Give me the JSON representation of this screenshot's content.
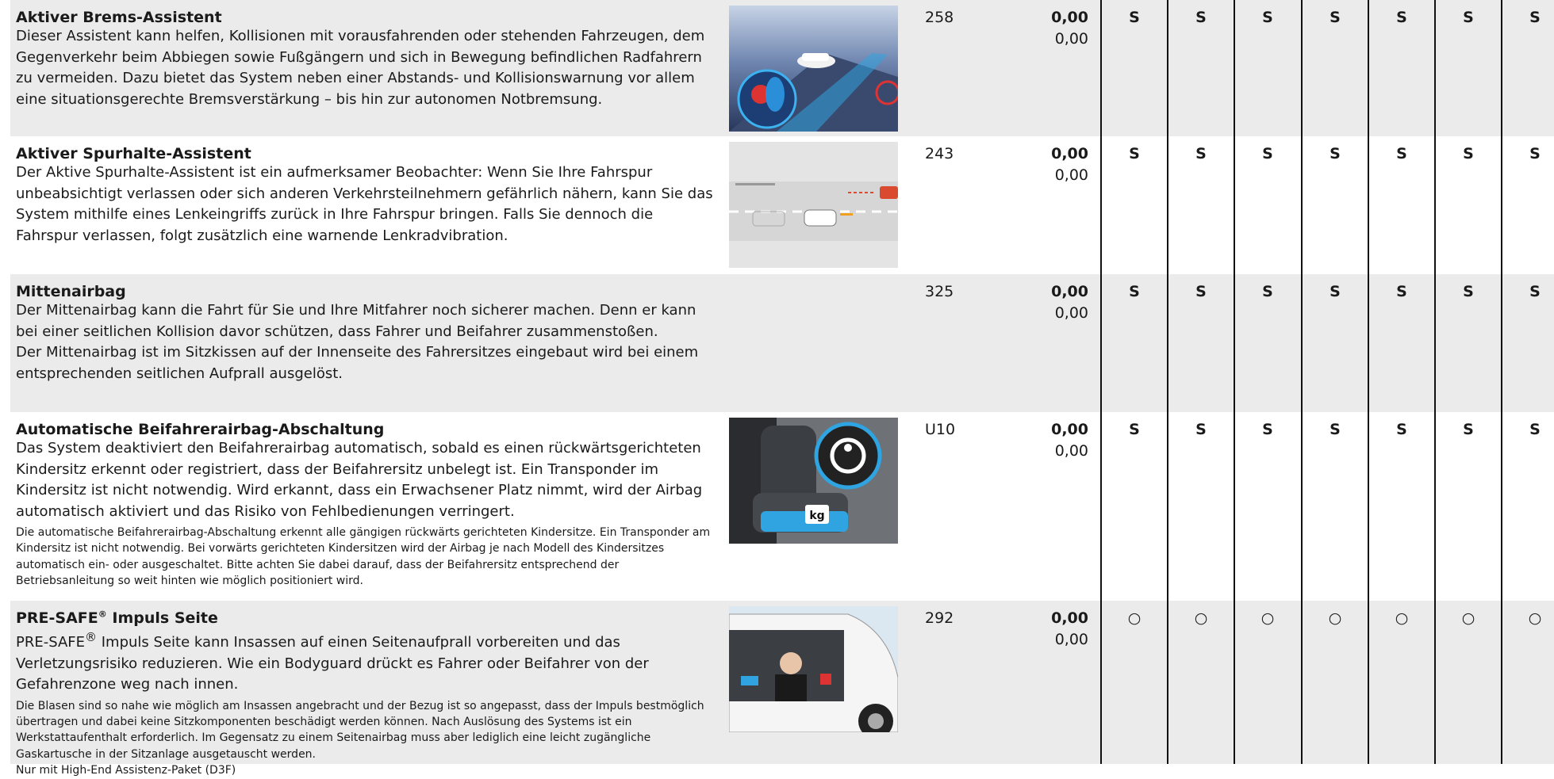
{
  "column_marks_count": 7,
  "rows": [
    {
      "title": "Aktiver Brems-Assistent",
      "body": "Dieser Assistent kann helfen, Kollisionen mit vorausfahrenden oder stehenden Fahrzeugen, dem Gegenverkehr beim Abbiegen sowie Fußgängern und sich in Bewegung befindlichen Radfahrern zu vermeiden. Dazu bietet das System neben einer Abstands- und Kollisionswarnung vor allem eine situationsgerechte Bremsverstärkung – bis hin zur autonomen Notbremsung.",
      "code": "258",
      "price_bold": "0,00",
      "price_regular": "0,00",
      "marks": [
        "S",
        "S",
        "S",
        "S",
        "S",
        "S",
        "S"
      ]
    },
    {
      "title": "Aktiver Spurhalte-Assistent",
      "body": "Der Aktive Spurhalte-Assistent ist ein aufmerksamer Beobachter: Wenn Sie Ihre Fahrspur unbeabsichtigt verlassen oder sich anderen Verkehrsteilnehmern gefährlich nähern, kann Sie das System mithilfe eines Lenkeingriffs zurück in Ihre Fahrspur bringen. Falls Sie dennoch die Fahrspur verlassen, folgt zusätzlich eine warnende Lenkradvibration.",
      "code": "243",
      "price_bold": "0,00",
      "price_regular": "0,00",
      "marks": [
        "S",
        "S",
        "S",
        "S",
        "S",
        "S",
        "S"
      ]
    },
    {
      "title": "Mittenairbag",
      "body": "Der Mittenairbag kann die Fahrt für Sie und Ihre Mitfahrer noch sicherer machen. Denn er kann bei einer seitlichen Kollision davor schützen, dass Fahrer und Beifahrer zusammenstoßen.",
      "body2": "Der Mittenairbag ist im Sitzkissen auf der Innenseite des Fahrersitzes eingebaut wird bei einem entsprechenden seitlichen Aufprall ausgelöst.",
      "code": "325",
      "price_bold": "0,00",
      "price_regular": "0,00",
      "marks": [
        "S",
        "S",
        "S",
        "S",
        "S",
        "S",
        "S"
      ]
    },
    {
      "title": "Automatische Beifahrerairbag-Abschaltung",
      "body": "Das System deaktiviert den Beifahrerairbag automatisch, sobald es einen rückwärtsgerichteten Kindersitz erkennt oder registriert, dass der Beifahrersitz unbelegt ist. Ein Transponder im Kindersitz ist nicht notwendig. Wird erkannt, dass ein Erwachsener Platz nimmt, wird der Airbag automatisch aktiviert und das Risiko von Fehlbedienungen verringert.",
      "note": "Die automatische Beifahrerairbag-Abschaltung erkennt alle gängigen rückwärts gerichteten Kindersitze. Ein Transponder am Kindersitz ist nicht notwendig. Bei vorwärts gerichteten Kindersitzen wird der Airbag je nach Modell des Kindersitzes automatisch ein- oder ausgeschaltet. Bitte achten Sie dabei darauf, dass der Beifahrersitz entsprechend der Betriebsanleitung so weit hinten wie möglich positioniert wird.",
      "image_label": "kg",
      "code": "U10",
      "price_bold": "0,00",
      "price_regular": "0,00",
      "marks": [
        "S",
        "S",
        "S",
        "S",
        "S",
        "S",
        "S"
      ]
    },
    {
      "title_main": "PRE-SAFE",
      "title_reg": "®",
      "title_rest": " Impuls Seite",
      "body_main": "PRE-SAFE",
      "body_reg": "®",
      "body_rest": " Impuls Seite kann Insassen auf einen Seitenaufprall vorbereiten und das Verletzungsrisiko reduzieren. Wie ein Bodyguard drückt es Fahrer oder Beifahrer von der Gefahrenzone weg nach innen.",
      "note": "Die Blasen sind so nahe wie möglich am Insassen angebracht und der Bezug ist so angepasst, dass der Impuls bestmöglich übertragen und dabei keine Sitzkomponenten beschädigt werden können. Nach Auslösung des Systems ist ein Werkstattaufenthalt erforderlich. Im Gegensatz zu einem Seitenairbag muss aber lediglich eine leicht zugängliche Gaskartusche in der Sitzanlage ausgetauscht werden.",
      "note2": "Nur mit High-End Assistenz-Paket (D3F)",
      "code": "292",
      "price_bold": "0,00",
      "price_regular": "0,00",
      "marks": [
        "○",
        "○",
        "○",
        "○",
        "○",
        "○",
        "○"
      ]
    }
  ],
  "colors": {
    "shade": "#ebebeb",
    "text": "#1a1a1a",
    "divider": "#111111"
  }
}
